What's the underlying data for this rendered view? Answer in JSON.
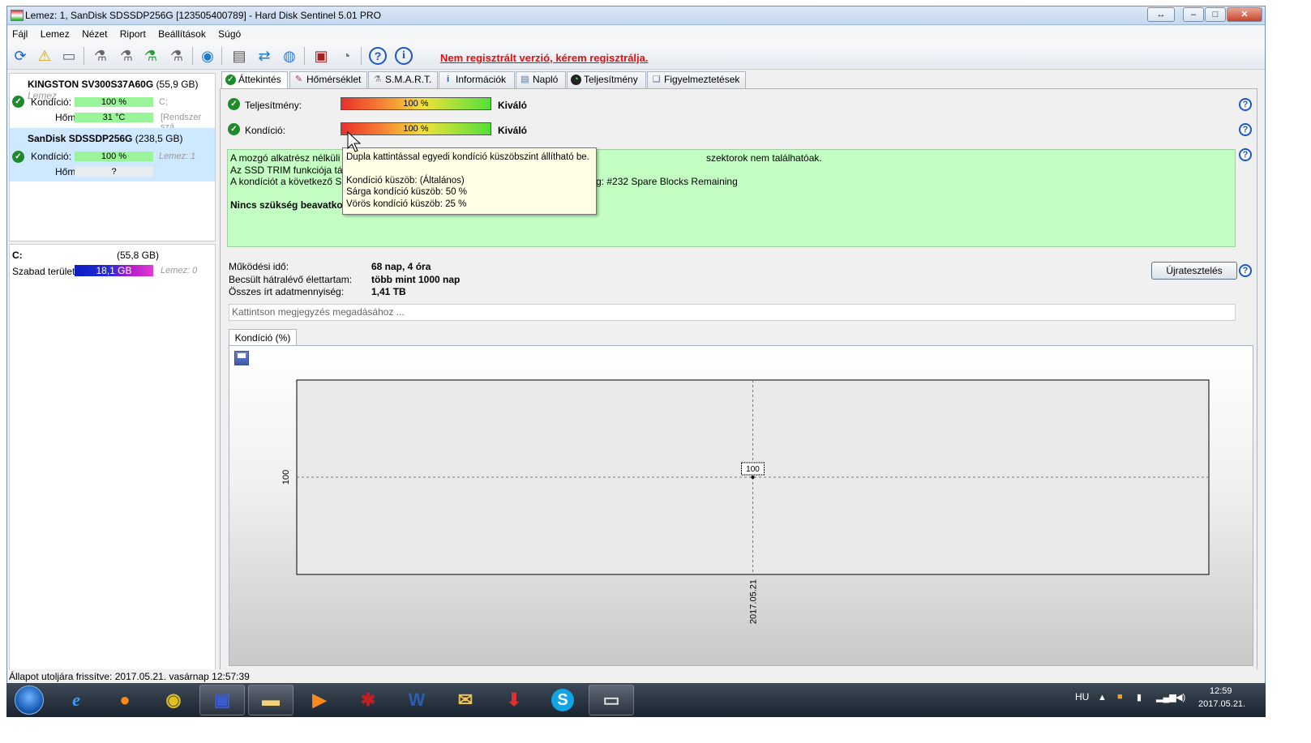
{
  "window": {
    "title": "Lemez: 1, SanDisk SDSSDP256G [123505400789]  -  Hard Disk Sentinel 5.01 PRO",
    "controls": [
      "↔",
      "–",
      "□",
      "✕"
    ]
  },
  "menu": [
    "Fájl",
    "Lemez",
    "Nézet",
    "Riport",
    "Beállítások",
    "Súgó"
  ],
  "toolbar": {
    "icons": [
      "refresh-icon",
      "alert-icon",
      "disk-icon",
      "test-icon",
      "test2-icon",
      "test-ok-icon",
      "test4-icon",
      "globe-icon",
      "report-icon",
      "sync-icon",
      "network-icon",
      "settings-icon",
      "sound-icon",
      "help-icon",
      "info-icon"
    ],
    "unregistered": "Nem regisztrált verzió, kérem regisztrálja."
  },
  "disks": [
    {
      "name": "KINGSTON SV300S37A60G",
      "size": "(55,9 GB)",
      "note": "Lemez",
      "kondicio_label": "Kondíció:",
      "kondicio_value": "100 %",
      "kondicio_side": "C;",
      "hom_label": "Hőm.:",
      "hom_value": "31 °C",
      "hom_side": "[Rendszer szá"
    },
    {
      "name": "SanDisk SDSSDP256G",
      "size": "(238,5 GB)",
      "kondicio_label": "Kondíció:",
      "kondicio_value": "100 %",
      "kondicio_side": "Lemez: 1",
      "hom_label": "Hőm.:",
      "hom_value": "?"
    }
  ],
  "volume": {
    "drive": "C:",
    "size": "(55,8 GB)",
    "free_label": "Szabad terület",
    "free_value": "18,1 GB",
    "disk": "Lemez: 0"
  },
  "tabs": [
    "Áttekintés",
    "Hőmérséklet",
    "S.M.A.R.T.",
    "Információk",
    "Napló",
    "Teljesítmény",
    "Figyelmeztetések"
  ],
  "overview": {
    "perf_label": "Teljesítmény:",
    "perf_value": "100 %",
    "perf_text": "Kiváló",
    "cond_label": "Kondíció:",
    "cond_value": "100 %",
    "cond_text": "Kiváló",
    "info_line1a": "A mozgó alkatrész nélküli m",
    "info_line1b": "szektorok nem találhatóak.",
    "info_line2": "Az SSD TRIM funkciója támo",
    "info_line3a": "A kondíciót a következő SSD",
    "info_line3b": "g:  #232 Spare Blocks Remaining",
    "info_line4": "Nincs szükség beavatkozá",
    "tooltip_line1": "Dupla kattintással egyedi kondíció küszöbszint állítható be.",
    "tooltip_line2": "Kondíció küszöb: (Általános)",
    "tooltip_line3": "Sárga kondíció küszöb: 50 %",
    "tooltip_line4": "Vörös kondíció küszöb: 25 %"
  },
  "stats": {
    "uptime_label": "Működési idő:",
    "uptime_value": "68 nap, 4 óra",
    "life_label": "Becsült hátralévő élettartam:",
    "life_value": "több mint 1000 nap",
    "written_label": "Összes írt adatmennyiség:",
    "written_value": "1,41 TB",
    "retest": "Újratesztelés",
    "note_placeholder": "Kattintson megjegyzés megadásához ..."
  },
  "chart_tab": "Kondíció  (%)",
  "chart_data": {
    "type": "line",
    "x": [
      "2017.05.21"
    ],
    "series": [
      {
        "values": [
          100
        ]
      }
    ],
    "ytick": "100",
    "point_label": "100"
  },
  "status": "Állapot utoljára frissítve: 2017.05.21. vasárnap 12:57:39",
  "taskbar": {
    "apps": [
      "ie-icon",
      "firefox-icon",
      "chrome-icon",
      "floppy-icon",
      "explorer-icon",
      "media-icon",
      "ant-icon",
      "word-icon",
      "outlook-icon",
      "download-icon",
      "skype-icon",
      "hds-icon"
    ],
    "lang": "HU",
    "time": "12:59",
    "date": "2017.05.21."
  }
}
